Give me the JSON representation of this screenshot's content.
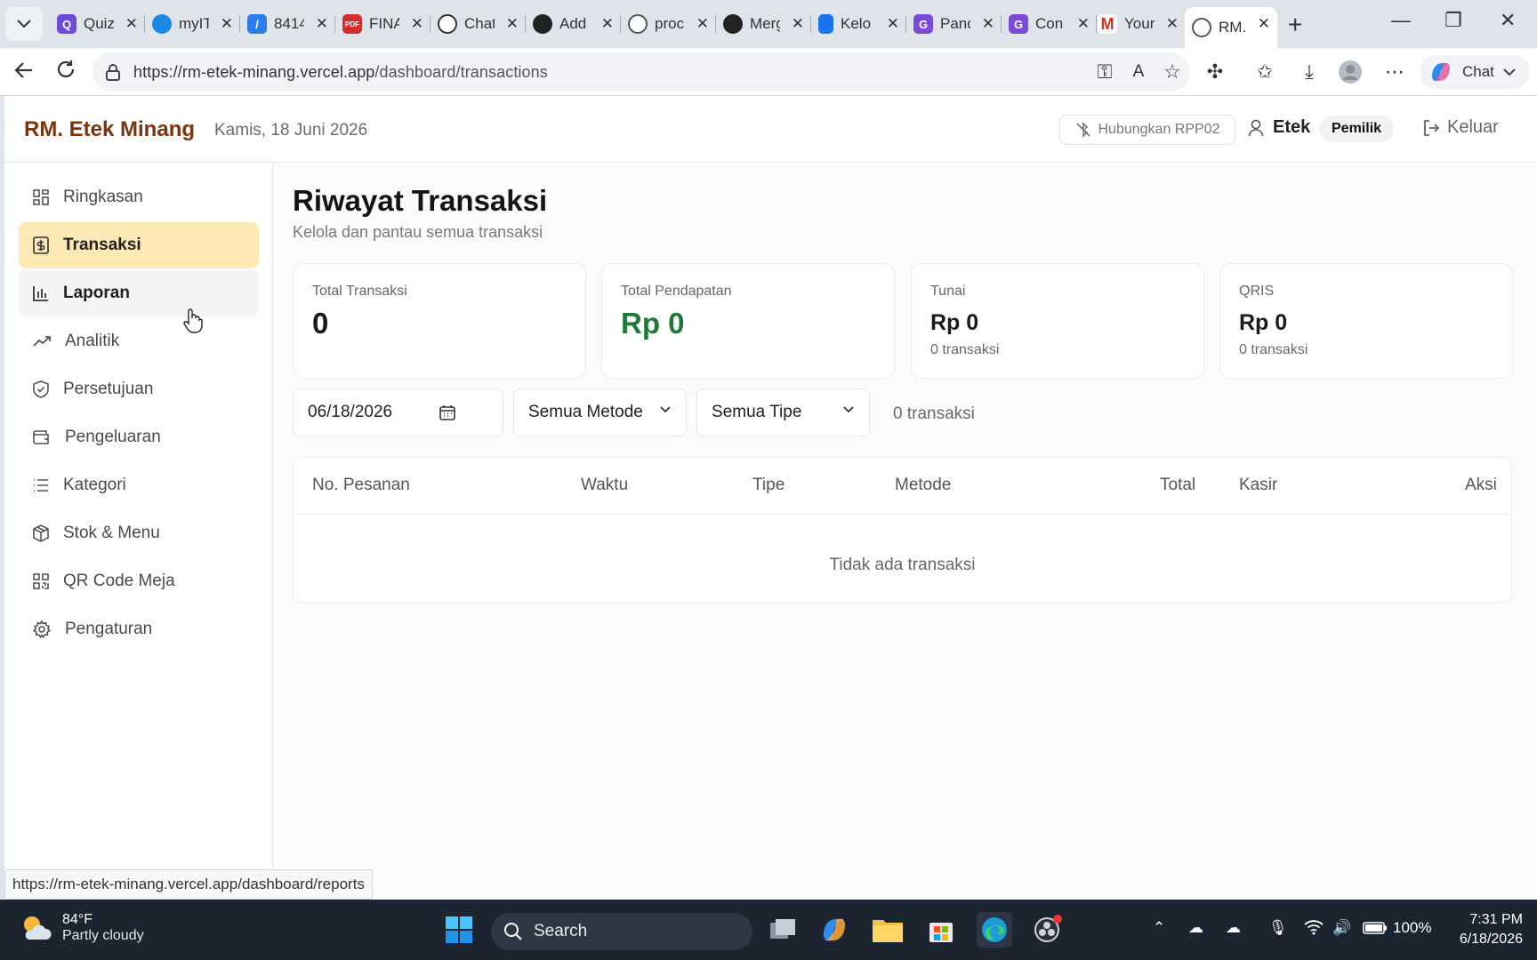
{
  "browser": {
    "tabs": [
      {
        "title": "Quiz",
        "icon": "quizizz-icon",
        "color": "#6c4ad6"
      },
      {
        "title": "myIT",
        "icon": "circle-blue-icon",
        "color": "#1e88e5"
      },
      {
        "title": "8414",
        "icon": "app-blue-icon",
        "color": "#2b7de9"
      },
      {
        "title": "FINAL",
        "icon": "pdf-icon",
        "color": "#d32f2f"
      },
      {
        "title": "ChatGPT",
        "icon": "chatgpt-icon",
        "color": "#333333"
      },
      {
        "title": "Add",
        "icon": "github-error-icon",
        "color": "#222222"
      },
      {
        "title": "proc",
        "icon": "globe-icon",
        "color": "#555555"
      },
      {
        "title": "Merge",
        "icon": "github-icon",
        "color": "#222222"
      },
      {
        "title": "Kelola",
        "icon": "docs-icon",
        "color": "#1a73e8"
      },
      {
        "title": "Panduan",
        "icon": "g-icon",
        "color": "#7b4ad6"
      },
      {
        "title": "Con",
        "icon": "g-icon",
        "color": "#7b4ad6"
      },
      {
        "title": "Your",
        "icon": "gmail-icon",
        "color": "#d93025"
      },
      {
        "title": "RM.",
        "icon": "globe-icon",
        "color": "#555555"
      }
    ],
    "url_host": "https://rm-etek-minang.vercel.app",
    "url_path": "/dashboard/transactions",
    "chat_label": "Chat",
    "status_url": "https://rm-etek-minang.vercel.app/dashboard/reports"
  },
  "header": {
    "brand": "RM. Etek Minang",
    "date": "Kamis, 18 Juni 2026",
    "printer": "Hubungkan RPP02",
    "user": "Etek",
    "role": "Pemilik",
    "logout": "Keluar"
  },
  "sidebar": {
    "items": [
      {
        "label": "Ringkasan",
        "icon": "dashboard-grid-icon",
        "state": "normal"
      },
      {
        "label": "Transaksi",
        "icon": "receipt-icon",
        "state": "active"
      },
      {
        "label": "Laporan",
        "icon": "bar-chart-icon",
        "state": "hover"
      },
      {
        "label": "Analitik",
        "icon": "trending-up-icon",
        "state": "normal"
      },
      {
        "label": "Persetujuan",
        "icon": "shield-check-icon",
        "state": "normal"
      },
      {
        "label": "Pengeluaran",
        "icon": "wallet-icon",
        "state": "normal"
      },
      {
        "label": "Kategori",
        "icon": "list-icon",
        "state": "normal"
      },
      {
        "label": "Stok & Menu",
        "icon": "package-icon",
        "state": "normal"
      },
      {
        "label": "QR Code Meja",
        "icon": "qr-code-icon",
        "state": "normal"
      },
      {
        "label": "Pengaturan",
        "icon": "gear-icon",
        "state": "normal"
      }
    ]
  },
  "page": {
    "title": "Riwayat Transaksi",
    "subtitle": "Kelola dan pantau semua transaksi"
  },
  "stats": [
    {
      "label": "Total Transaksi",
      "value": "0",
      "sub": ""
    },
    {
      "label": "Total Pendapatan",
      "value": "Rp 0",
      "sub": ""
    },
    {
      "label": "Tunai",
      "value": "Rp 0",
      "sub": "0 transaksi"
    },
    {
      "label": "QRIS",
      "value": "Rp 0",
      "sub": "0 transaksi"
    }
  ],
  "filters": {
    "date": "06/18/2026",
    "method": "Semua Metode",
    "type": "Semua Tipe",
    "count": "0 transaksi"
  },
  "table": {
    "columns": [
      "No. Pesanan",
      "Waktu",
      "Tipe",
      "Metode",
      "Total",
      "Kasir",
      "Aksi"
    ],
    "empty_text": "Tidak ada transaksi"
  },
  "taskbar": {
    "temp": "84°F",
    "weather": "Partly cloudy",
    "search": "Search",
    "battery": "100%",
    "time": "7:31 PM",
    "date": "6/18/2026"
  },
  "colors": {
    "brand": "#7a3410",
    "active_nav": "#fde9b6",
    "revenue": "#1f7a3a"
  }
}
